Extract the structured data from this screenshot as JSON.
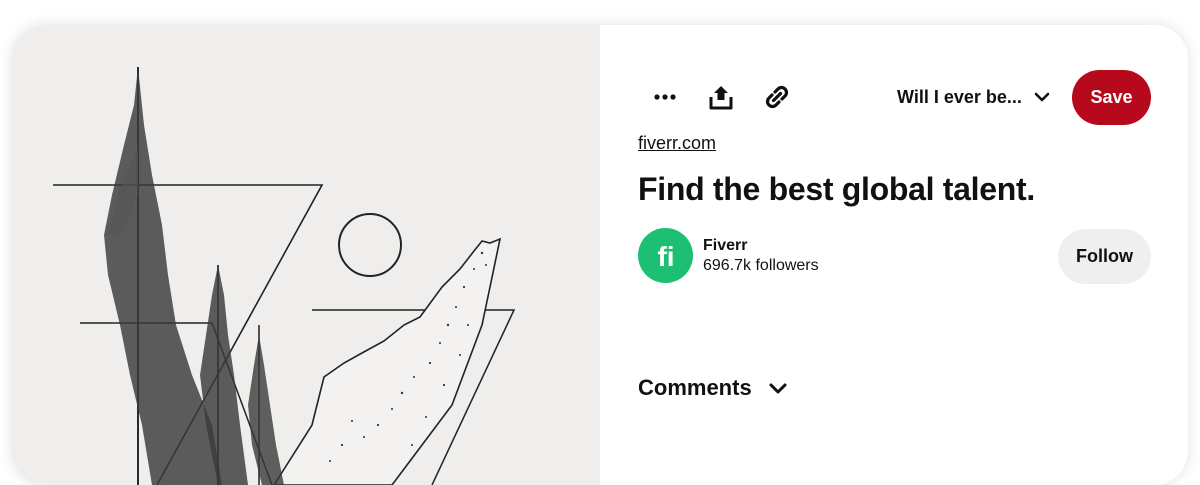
{
  "pin_image": {
    "alt_description": "",
    "background_color": "#efeeec"
  },
  "toolbar": {
    "more_icon": "ellipsis-icon",
    "share_icon": "upload-share-icon",
    "link_icon": "chain-link-icon",
    "board_select_label": "Will I ever be...",
    "board_select_icon": "chevron-down-icon",
    "save_label": "Save",
    "save_color": "#b60a1c"
  },
  "pin": {
    "source_link": "fiverr.com",
    "title": "Find the best global talent."
  },
  "creator": {
    "name": "Fiverr",
    "followers": "696.7k followers",
    "avatar_text": "fi",
    "avatar_color": "#1dbf73",
    "follow_label": "Follow"
  },
  "comments": {
    "label": "Comments",
    "toggle_icon": "chevron-down-icon"
  }
}
